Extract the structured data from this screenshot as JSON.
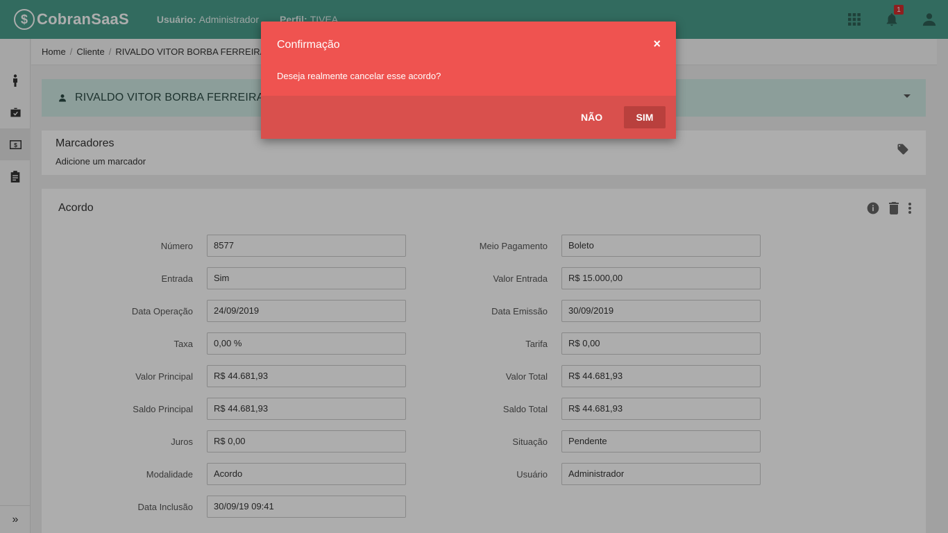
{
  "topbar": {
    "brand": "CobranSaaS",
    "user_label": "Usuário:",
    "user_value": "Administrador",
    "profile_label": "Perfil:",
    "profile_value": "TIVEA",
    "notification_count": "1",
    "bg_color": "#4a9e8c"
  },
  "breadcrumb": {
    "items": [
      "Home",
      "Cliente",
      "RIVALDO VITOR BORBA FERREIRA"
    ]
  },
  "client": {
    "name": "RIVALDO VITOR BORBA FERREIRA"
  },
  "marcadores": {
    "title": "Marcadores",
    "subtitle": "Adicione um marcador"
  },
  "acordo": {
    "title": "Acordo",
    "left_fields": [
      {
        "label": "Número",
        "value": "8577"
      },
      {
        "label": "Entrada",
        "value": "Sim"
      },
      {
        "label": "Data Operação",
        "value": "24/09/2019"
      },
      {
        "label": "Taxa",
        "value": "0,00 %"
      },
      {
        "label": "Valor Principal",
        "value": "R$ 44.681,93"
      },
      {
        "label": "Saldo Principal",
        "value": "R$ 44.681,93"
      },
      {
        "label": "Juros",
        "value": "R$ 0,00"
      },
      {
        "label": "Modalidade",
        "value": "Acordo"
      },
      {
        "label": "Data Inclusão",
        "value": "30/09/19 09:41"
      }
    ],
    "right_fields": [
      {
        "label": "Meio Pagamento",
        "value": "Boleto"
      },
      {
        "label": "Valor Entrada",
        "value": "R$ 15.000,00"
      },
      {
        "label": "Data Emissão",
        "value": "30/09/2019"
      },
      {
        "label": "Tarifa",
        "value": "R$ 0,00"
      },
      {
        "label": "Valor Total",
        "value": "R$ 44.681,93"
      },
      {
        "label": "Saldo Total",
        "value": "R$ 44.681,93"
      },
      {
        "label": "Situação",
        "value": "Pendente"
      },
      {
        "label": "Usuário",
        "value": "Administrador"
      }
    ]
  },
  "dialog": {
    "title": "Confirmação",
    "close": "×",
    "message": "Deseja realmente cancelar esse acordo?",
    "cancel_label": "NÃO",
    "confirm_label": "SIM",
    "color": "#ef5350"
  },
  "rail": {
    "expand_glyph": "»"
  },
  "icons": [
    "person-icon",
    "briefcase-icon",
    "money-icon",
    "clipboard-icon",
    "apps-grid-icon",
    "bell-icon",
    "account-icon",
    "tag-icon",
    "info-icon",
    "trash-icon",
    "more-vert-icon"
  ]
}
